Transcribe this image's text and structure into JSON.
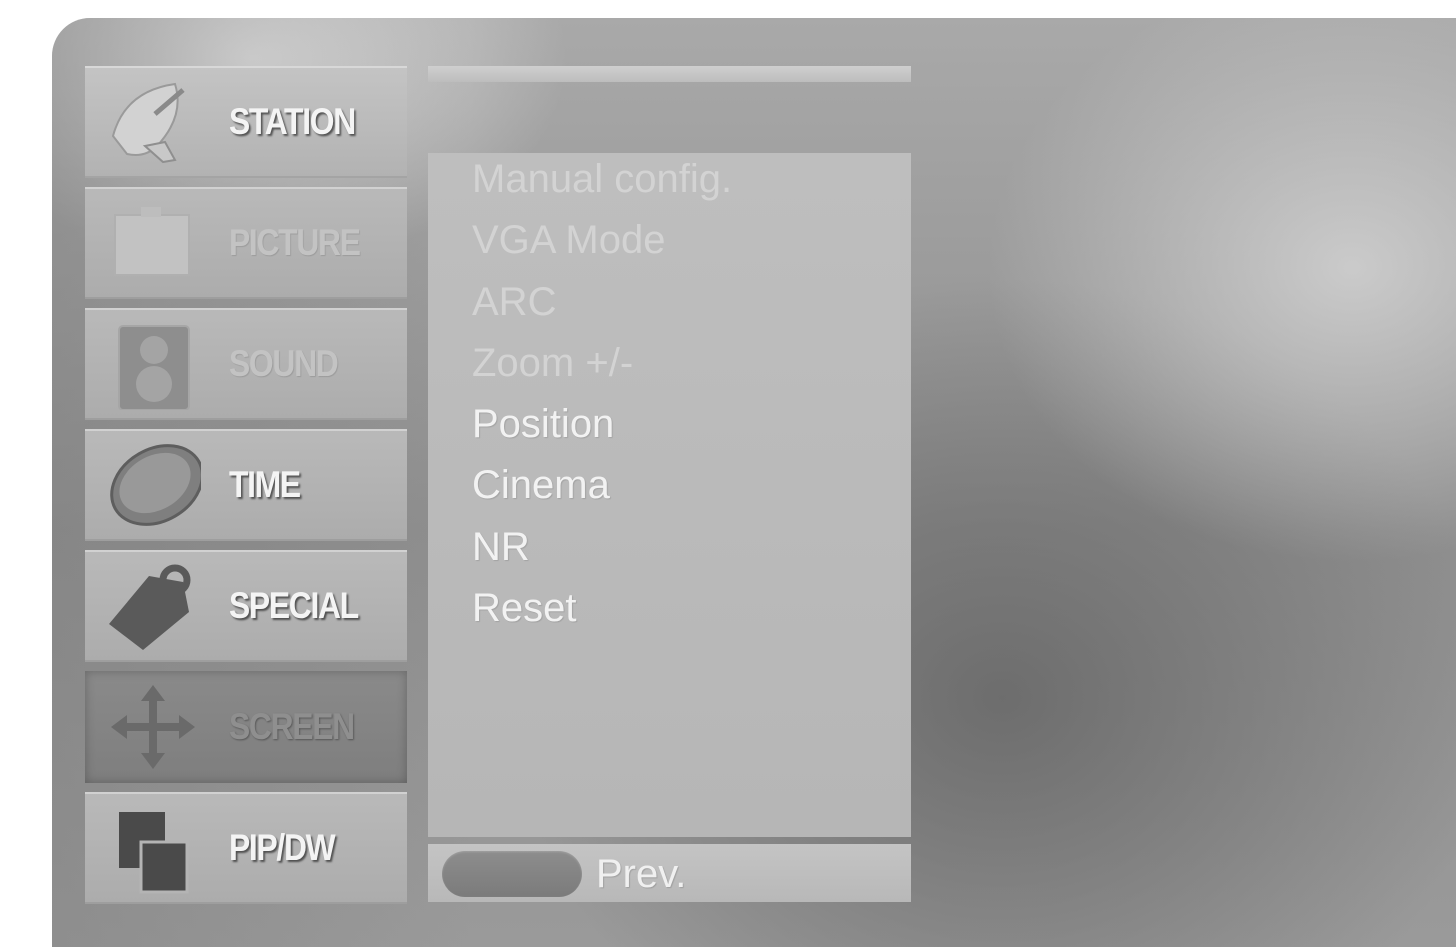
{
  "menu": {
    "items": [
      {
        "label": "STATION",
        "icon": "satellite-dish-icon"
      },
      {
        "label": "PICTURE",
        "icon": "tv-screen-icon"
      },
      {
        "label": "SOUND",
        "icon": "speaker-icon"
      },
      {
        "label": "TIME",
        "icon": "clock-icon"
      },
      {
        "label": "SPECIAL",
        "icon": "tag-icon"
      },
      {
        "label": "SCREEN",
        "icon": "move-arrows-icon"
      },
      {
        "label": "PIP/DW",
        "icon": "pip-windows-icon"
      }
    ],
    "selected": "SCREEN"
  },
  "submenu": {
    "items": [
      "Manual config.",
      "VGA Mode",
      "ARC",
      "Zoom +/-",
      "Position",
      "Cinema",
      "NR",
      "Reset"
    ]
  },
  "footer": {
    "prev_label": "Prev."
  }
}
